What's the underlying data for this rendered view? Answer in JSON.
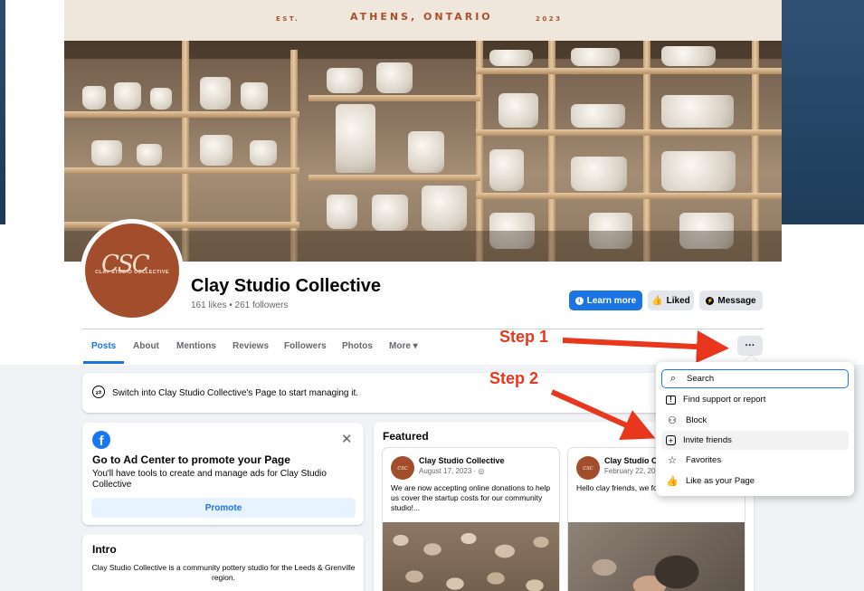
{
  "banner": {
    "est": "EST.",
    "location": "ATHENS, ONTARIO",
    "year": "2023"
  },
  "page": {
    "name": "Clay Studio Collective",
    "stats": "161 likes • 261 followers",
    "avatar_text": "CLAY STUDIO COLLECTIVE",
    "avatar_script": "CSC"
  },
  "actions": {
    "learn_more": "Learn more",
    "liked": "Liked",
    "message": "Message",
    "more": "···"
  },
  "tabs": [
    "Posts",
    "About",
    "Mentions",
    "Reviews",
    "Followers",
    "Photos",
    "More ▾"
  ],
  "annotations": {
    "step1": "Step 1",
    "step2": "Step 2"
  },
  "switch_notice": "Switch into Clay Studio Collective's Page to start managing it.",
  "ad_center": {
    "title": "Go to Ad Center to promote your Page",
    "description": "You'll have tools to create and manage ads for Clay Studio Collective",
    "button": "Promote"
  },
  "intro": {
    "title": "Intro",
    "text": "Clay Studio Collective is a community pottery studio for the Leeds & Grenville region."
  },
  "featured": {
    "title": "Featured",
    "posts": [
      {
        "author": "Clay Studio Collective",
        "date": "August 17, 2023 · ◎",
        "text": "We are now accepting online donations to help us cover the startup costs for our community studio!..."
      },
      {
        "author": "Clay Studio C",
        "date": "February 22, 20",
        "text": "Hello clay friends, we found us! ..."
      }
    ]
  },
  "menu": {
    "items": [
      {
        "label": "Search",
        "icon": "search-icon"
      },
      {
        "label": "Find support or report",
        "icon": "report-icon"
      },
      {
        "label": "Block",
        "icon": "block-user-icon"
      },
      {
        "label": "Invite friends",
        "icon": "invite-icon"
      },
      {
        "label": "Favorites",
        "icon": "star-icon"
      },
      {
        "label": "Like as your Page",
        "icon": "thumbs-up-icon"
      }
    ]
  },
  "colors": {
    "accent": "#1b74e4",
    "annotation": "#e8371d",
    "brand_clay": "#a24d2b"
  }
}
